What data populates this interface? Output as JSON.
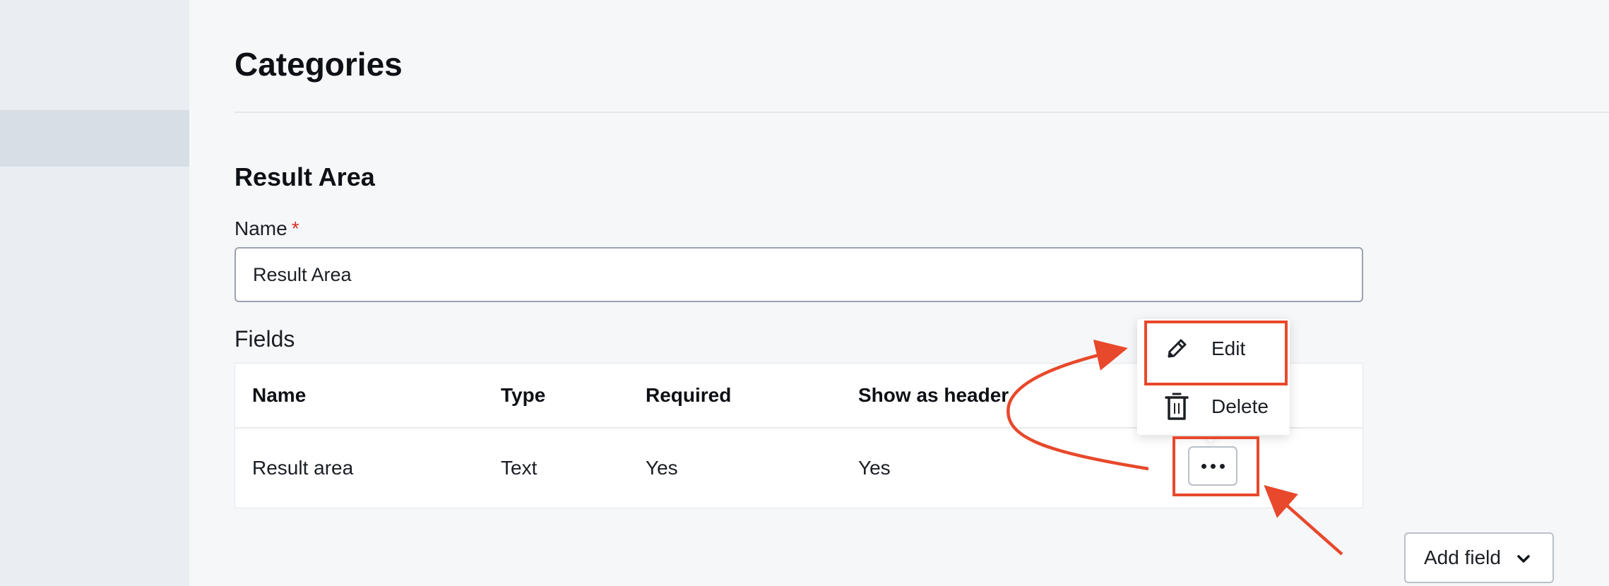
{
  "page": {
    "title": "Categories"
  },
  "form": {
    "section_title": "Result Area",
    "name_label": "Name",
    "required_mark": "*",
    "name_value": "Result Area"
  },
  "fields": {
    "label": "Fields",
    "columns": [
      "Name",
      "Type",
      "Required",
      "Show as header"
    ],
    "rows": [
      {
        "name": "Result area",
        "type": "Text",
        "required": "Yes",
        "show_as_header": "Yes"
      }
    ]
  },
  "row_menu": {
    "items": [
      {
        "label": "Edit",
        "icon": "pencil-icon"
      },
      {
        "label": "Delete",
        "icon": "trash-icon"
      }
    ],
    "trigger_icon": "more-dots-icon"
  },
  "actions": {
    "add_field_label": "Add field",
    "add_field_icon": "chevron-down-icon"
  },
  "colors": {
    "annotation": "#e8482b",
    "required": "#d93025",
    "sidebar": "#eaedf1",
    "sidebar_active": "#d8dee5",
    "background": "#f6f7f9"
  }
}
